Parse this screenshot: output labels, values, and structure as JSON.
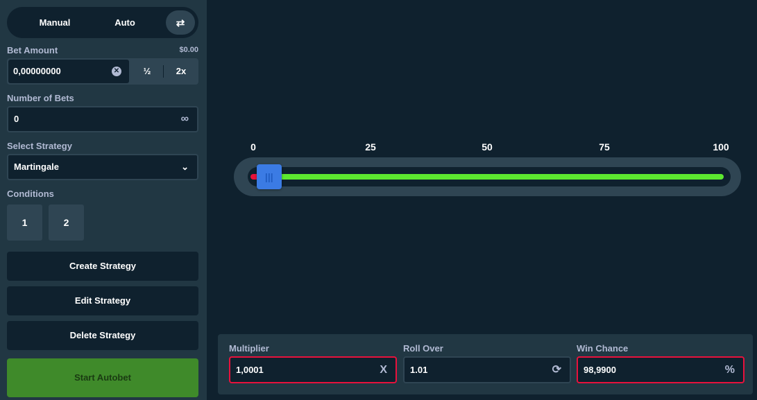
{
  "sidebar": {
    "tabs": [
      "Manual",
      "Auto"
    ],
    "bet_amount": {
      "label": "Bet Amount",
      "usd": "$0.00",
      "value": "0,00000000",
      "half": "½",
      "double": "2x"
    },
    "number_of_bets": {
      "label": "Number of Bets",
      "value": "0"
    },
    "strategy": {
      "label": "Select Strategy",
      "value": "Martingale"
    },
    "conditions": {
      "label": "Conditions",
      "items": [
        "1",
        "2"
      ]
    },
    "buttons": {
      "create": "Create Strategy",
      "edit": "Edit Strategy",
      "delete": "Delete Strategy",
      "start": "Start Autobet"
    },
    "colors": {
      "start": "#3f8a2a",
      "start_text": "#1a3b12"
    }
  },
  "slider": {
    "ticks": [
      "0",
      "25",
      "50",
      "75",
      "100"
    ],
    "value": 1.01,
    "colors": {
      "win": "#5ce830",
      "lose": "#e9113c",
      "handle": "#3b7be4"
    }
  },
  "bottom": {
    "multiplier": {
      "label": "Multiplier",
      "value": "1,0001",
      "suffix": "X"
    },
    "roll_over": {
      "label": "Roll Over",
      "value": "1.01",
      "suffix": "⟳"
    },
    "win_chance": {
      "label": "Win Chance",
      "value": "98,9900",
      "suffix": "%"
    }
  }
}
